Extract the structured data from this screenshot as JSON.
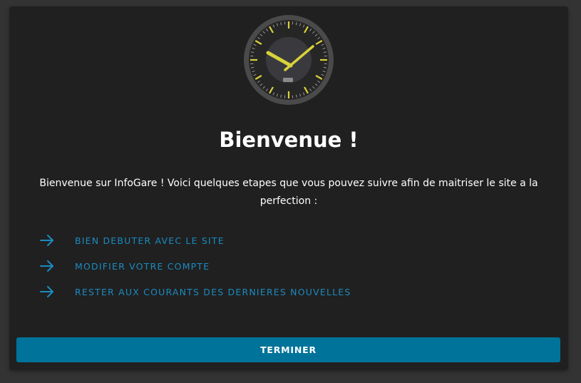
{
  "dialog": {
    "clock_icon": "wall-clock-icon",
    "title": "Bienvenue !",
    "intro": "Bienvenue sur InfoGare ! Voici quelques etapes que vous pouvez suivre afin de maitriser le site a la perfection :",
    "steps": [
      {
        "icon": "arrow-right-icon",
        "label": "BIEN DEBUTER AVEC LE SITE"
      },
      {
        "icon": "arrow-right-icon",
        "label": "MODIFIER VOTRE COMPTE"
      },
      {
        "icon": "arrow-right-icon",
        "label": "RESTER AUX COURANTS DES DERNIERES NOUVELLES"
      }
    ],
    "finish_label": "TERMINER"
  },
  "colors": {
    "page_background": "#333333",
    "dialog_background": "#202020",
    "link": "#1b8bbf",
    "button": "#00739a",
    "clock_hands": "#d9d23a"
  }
}
